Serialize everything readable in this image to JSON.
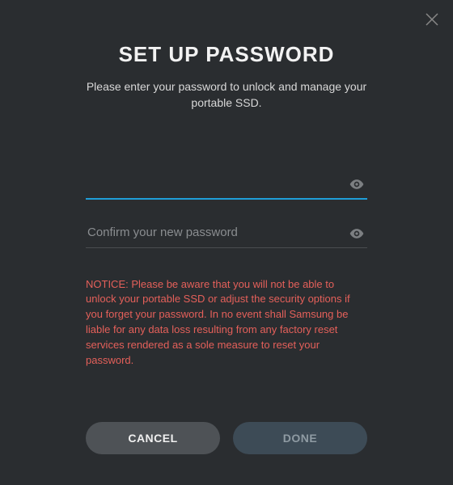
{
  "title": "SET UP PASSWORD",
  "subtitle": "Please enter your password to unlock and manage your portable SSD.",
  "fields": {
    "password": {
      "placeholder": "",
      "value": ""
    },
    "confirm": {
      "placeholder": "Confirm your new password",
      "value": ""
    }
  },
  "notice": "NOTICE: Please be aware that you will not be able to unlock your portable SSD or adjust the security options if you forget your password. In no event shall Samsung be liable for any data loss resulting from any factory reset services rendered as a sole measure to reset your password.",
  "buttons": {
    "cancel": "CANCEL",
    "done": "DONE"
  },
  "colors": {
    "bg": "#2a2d30",
    "accent": "#1f9ed8",
    "error": "#e4605a",
    "cancel_bg": "#4e5256",
    "done_bg": "#3d4b56"
  }
}
